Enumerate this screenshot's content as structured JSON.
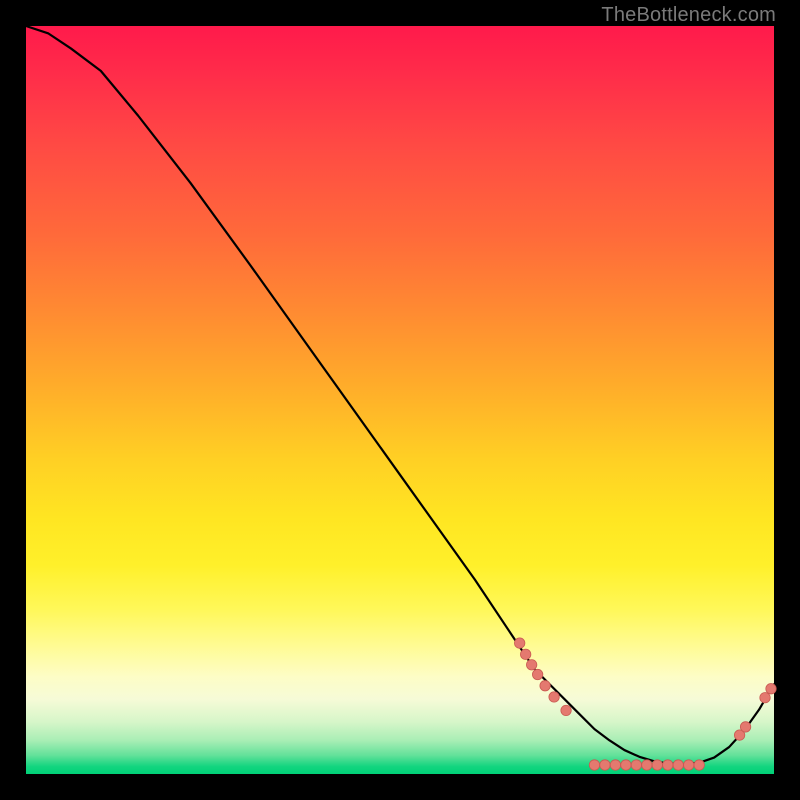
{
  "watermark": "TheBottleneck.com",
  "colors": {
    "curve": "#000000",
    "marker_fill": "#e4796f",
    "marker_stroke": "#c95a52",
    "gradient_top": "#ff1a4b",
    "gradient_bottom": "#00d178"
  },
  "chart_data": {
    "type": "line",
    "title": "",
    "xlabel": "",
    "ylabel": "",
    "xlim": [
      0,
      100
    ],
    "ylim": [
      0,
      100
    ],
    "grid": false,
    "legend": false,
    "curve": {
      "x": [
        0,
        3,
        6,
        10,
        15,
        22,
        30,
        40,
        50,
        60,
        66,
        68,
        70,
        72,
        74,
        76,
        78,
        80,
        82,
        84,
        86,
        88,
        90,
        92,
        94,
        96,
        98,
        100
      ],
      "y": [
        100,
        99,
        97,
        94,
        88,
        79,
        68,
        54,
        40,
        26,
        17,
        14,
        12,
        10,
        8,
        6,
        4.5,
        3.2,
        2.3,
        1.7,
        1.4,
        1.3,
        1.5,
        2.2,
        3.6,
        5.8,
        8.6,
        12
      ]
    },
    "markers": [
      {
        "x": 66.0,
        "y": 17.5
      },
      {
        "x": 66.8,
        "y": 16.0
      },
      {
        "x": 67.6,
        "y": 14.6
      },
      {
        "x": 68.4,
        "y": 13.3
      },
      {
        "x": 69.4,
        "y": 11.8
      },
      {
        "x": 70.6,
        "y": 10.3
      },
      {
        "x": 72.2,
        "y": 8.5
      },
      {
        "x": 76.0,
        "y": 1.2
      },
      {
        "x": 77.4,
        "y": 1.2
      },
      {
        "x": 78.8,
        "y": 1.2
      },
      {
        "x": 80.2,
        "y": 1.2
      },
      {
        "x": 81.6,
        "y": 1.2
      },
      {
        "x": 83.0,
        "y": 1.2
      },
      {
        "x": 84.4,
        "y": 1.2
      },
      {
        "x": 85.8,
        "y": 1.2
      },
      {
        "x": 87.2,
        "y": 1.2
      },
      {
        "x": 88.6,
        "y": 1.2
      },
      {
        "x": 90.0,
        "y": 1.2
      },
      {
        "x": 95.4,
        "y": 5.2
      },
      {
        "x": 96.2,
        "y": 6.3
      },
      {
        "x": 98.8,
        "y": 10.2
      },
      {
        "x": 99.6,
        "y": 11.4
      }
    ]
  }
}
